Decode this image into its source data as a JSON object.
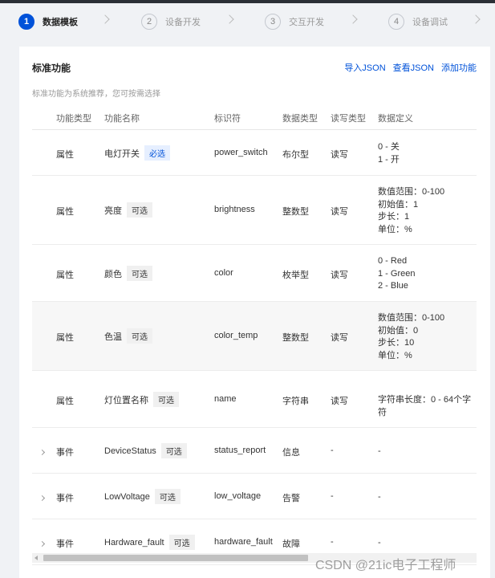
{
  "steps": [
    {
      "num": "1",
      "label": "数据模板"
    },
    {
      "num": "2",
      "label": "设备开发"
    },
    {
      "num": "3",
      "label": "交互开发"
    },
    {
      "num": "4",
      "label": "设备调试"
    }
  ],
  "card": {
    "title": "标准功能",
    "desc": "标准功能为系统推荐，您可按需选择",
    "links": {
      "import": "导入JSON",
      "view": "查看JSON",
      "add": "添加功能"
    }
  },
  "table": {
    "headers": {
      "type": "功能类型",
      "name": "功能名称",
      "id": "标识符",
      "datatype": "数据类型",
      "rw": "读写类型",
      "def": "数据定义"
    },
    "rows": [
      {
        "type": "属性",
        "name": "电灯开关",
        "tag": "必选",
        "id": "power_switch",
        "datatype": "布尔型",
        "rw": "读写",
        "def": [
          "0 - 关",
          "1 - 开"
        ]
      },
      {
        "type": "属性",
        "name": "亮度",
        "tag": "可选",
        "id": "brightness",
        "datatype": "整数型",
        "rw": "读写",
        "def": [
          "数值范围：0-100",
          "初始值：1",
          "步长：1",
          "单位：%"
        ]
      },
      {
        "type": "属性",
        "name": "颜色",
        "tag": "可选",
        "id": "color",
        "datatype": "枚举型",
        "rw": "读写",
        "def": [
          "0 - Red",
          "1 - Green",
          "2 - Blue"
        ]
      },
      {
        "type": "属性",
        "name": "色温",
        "tag": "可选",
        "id": "color_temp",
        "datatype": "整数型",
        "rw": "读写",
        "def": [
          "数值范围：0-100",
          "初始值：0",
          "步长：10",
          "单位：%"
        ]
      },
      {
        "type": "属性",
        "name": "灯位置名称",
        "tag": "可选",
        "id": "name",
        "datatype": "字符串",
        "rw": "读写",
        "def": [
          "字符串长度：0 - 64个字符"
        ]
      },
      {
        "type": "事件",
        "name": "DeviceStatus",
        "tag": "可选",
        "id": "status_report",
        "datatype": "信息",
        "rw": "-",
        "def": [
          "-"
        ]
      },
      {
        "type": "事件",
        "name": "LowVoltage",
        "tag": "可选",
        "id": "low_voltage",
        "datatype": "告警",
        "rw": "-",
        "def": [
          "-"
        ]
      },
      {
        "type": "事件",
        "name": "Hardware_fault",
        "tag": "可选",
        "id": "hardware_fault",
        "datatype": "故障",
        "rw": "-",
        "def": [
          "-"
        ]
      }
    ]
  },
  "watermark": "CSDN @21ic电子工程师",
  "colors": {
    "accent": "#0052d9",
    "required_tag_bg": "#e6efff",
    "highlight_row": "#f7f7f7"
  }
}
